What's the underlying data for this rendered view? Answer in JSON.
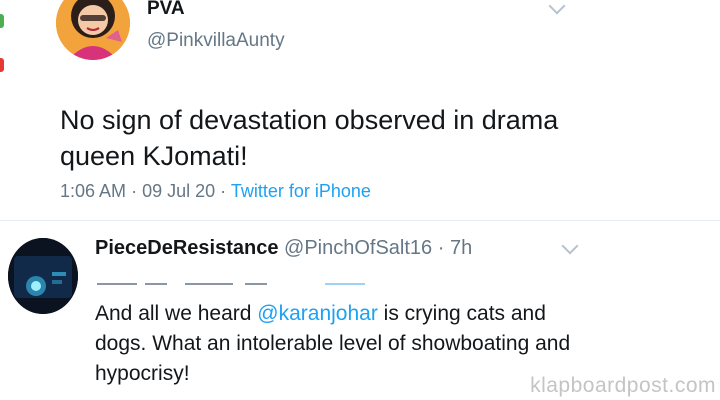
{
  "colors": {
    "accent": "#1da1f2",
    "text": "#14171a",
    "muted": "#657786",
    "divider": "#e6ecf0"
  },
  "main_tweet": {
    "author_name": "PVA",
    "author_handle": "@PinkvillaAunty",
    "text": "No sign of devastation observed in drama queen KJomati!",
    "time": "1:06 AM",
    "date": "09 Jul 20",
    "separator": "·",
    "source": "Twitter for iPhone",
    "menu_icon": "chevron-down-icon",
    "avatar_icon": "cartoon-avatar"
  },
  "reply": {
    "author_name": "PieceDeResistance",
    "author_handle": "@PinchOfSalt16",
    "separator": "·",
    "age": "7h",
    "menu_icon": "chevron-down-icon",
    "avatar_icon": "dark-avatar",
    "text_before": "And all we heard ",
    "mention": "@karanjohar",
    "text_after": " is crying cats and dogs. What an intolerable level of showboating and hypocrisy!"
  },
  "watermark": "klapboardpost.com"
}
